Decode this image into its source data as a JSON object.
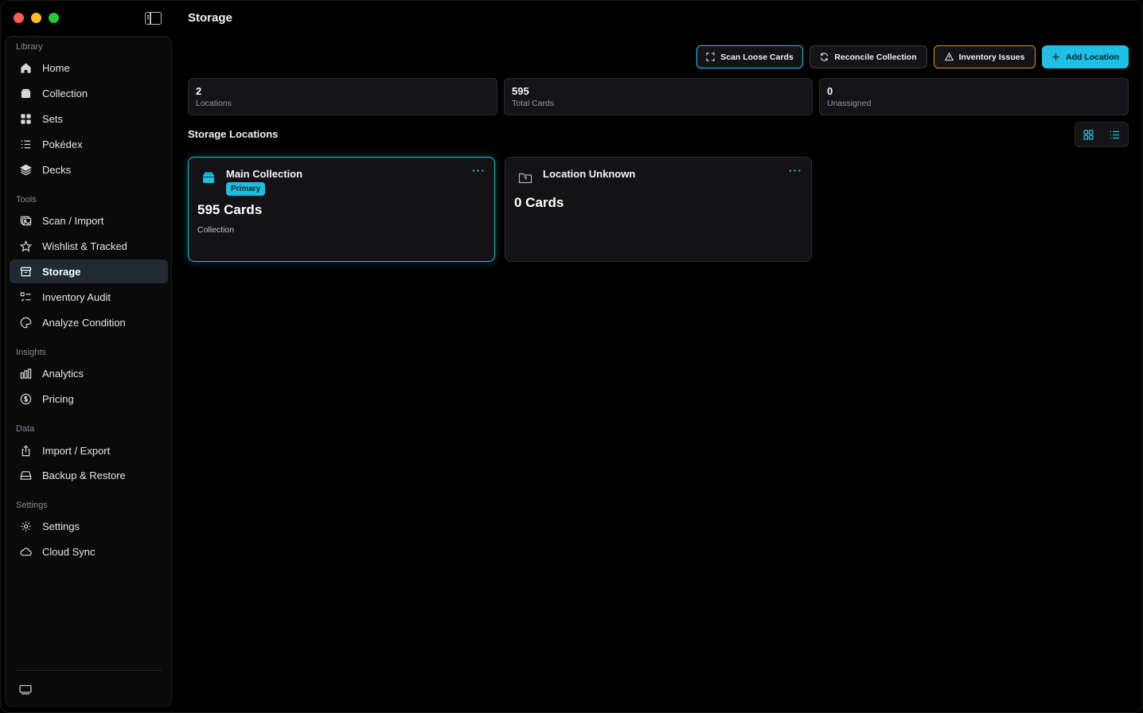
{
  "header": {
    "title": "Storage"
  },
  "sidebar": {
    "sections": [
      {
        "label": "Library"
      },
      {
        "label": "Tools"
      },
      {
        "label": "Insights"
      },
      {
        "label": "Data"
      },
      {
        "label": "Settings"
      }
    ],
    "items": [
      {
        "label": "Home",
        "icon": "home-icon"
      },
      {
        "label": "Collection",
        "icon": "box-icon"
      },
      {
        "label": "Sets",
        "icon": "grid-icon"
      },
      {
        "label": "Pokédex",
        "icon": "list-icon"
      },
      {
        "label": "Decks",
        "icon": "layers-icon"
      },
      {
        "label": "Scan / Import",
        "icon": "photo-scan-icon"
      },
      {
        "label": "Wishlist & Tracked",
        "icon": "star-icon"
      },
      {
        "label": "Storage",
        "icon": "archive-icon",
        "active": true
      },
      {
        "label": "Inventory Audit",
        "icon": "checklist-icon"
      },
      {
        "label": "Analyze Condition",
        "icon": "palette-icon"
      },
      {
        "label": "Analytics",
        "icon": "bar-chart-icon"
      },
      {
        "label": "Pricing",
        "icon": "dollar-circle-icon"
      },
      {
        "label": "Import / Export",
        "icon": "share-icon"
      },
      {
        "label": "Backup & Restore",
        "icon": "drive-icon"
      },
      {
        "label": "Settings",
        "icon": "gear-icon"
      },
      {
        "label": "Cloud Sync",
        "icon": "cloud-icon"
      }
    ]
  },
  "toolbar": {
    "scan_label": "Scan Loose Cards",
    "reconcile_label": "Reconcile Collection",
    "issues_label": "Inventory Issues",
    "add_label": "Add Location"
  },
  "stats": [
    {
      "value": "2",
      "label": "Locations"
    },
    {
      "value": "595",
      "label": "Total Cards"
    },
    {
      "value": "0",
      "label": "Unassigned"
    }
  ],
  "storage": {
    "section_title": "Storage Locations",
    "locations": [
      {
        "name": "Main Collection",
        "badge": "Primary",
        "count": "595 Cards",
        "subtitle": "Collection",
        "menu": "···"
      },
      {
        "name": "Location Unknown",
        "count": "0 Cards",
        "menu": "···"
      }
    ]
  },
  "colors": {
    "accent": "#1ec0e5",
    "warning": "#d8923a",
    "active_item_bg": "#1f2a33"
  }
}
